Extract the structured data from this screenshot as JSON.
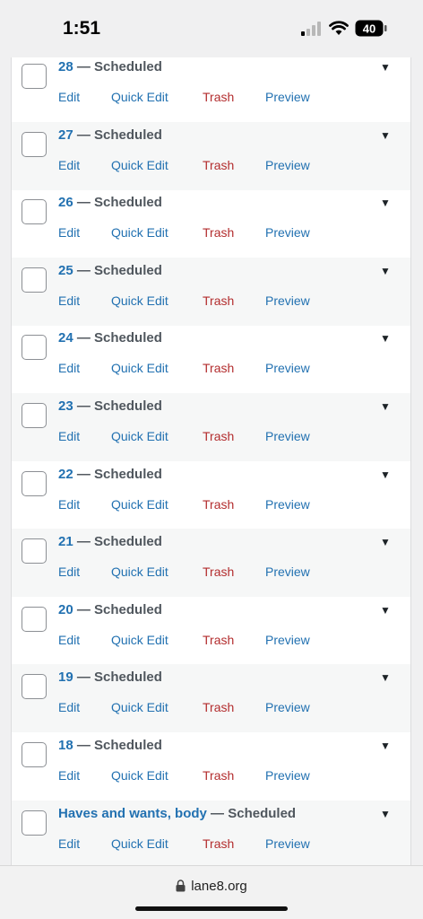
{
  "status": {
    "time": "1:51",
    "battery_level": "40",
    "signal_icon": "cellular-signal-icon",
    "wifi_icon": "wifi-icon",
    "battery_icon": "battery-icon"
  },
  "colors": {
    "link": "#2271b1",
    "trash": "#b32d2e",
    "muted_text": "#50575e",
    "row_alt_bg": "#f6f7f7"
  },
  "row_actions": {
    "edit": "Edit",
    "quick_edit": "Quick Edit",
    "trash": "Trash",
    "preview": "Preview"
  },
  "posts": [
    {
      "title": "28",
      "state": " — Scheduled"
    },
    {
      "title": "27",
      "state": " — Scheduled"
    },
    {
      "title": "26",
      "state": " — Scheduled"
    },
    {
      "title": "25",
      "state": " — Scheduled"
    },
    {
      "title": "24",
      "state": " — Scheduled"
    },
    {
      "title": "23",
      "state": " — Scheduled"
    },
    {
      "title": "22",
      "state": " — Scheduled"
    },
    {
      "title": "21",
      "state": " — Scheduled"
    },
    {
      "title": "20",
      "state": " — Scheduled"
    },
    {
      "title": "19",
      "state": " — Scheduled"
    },
    {
      "title": "18",
      "state": " — Scheduled"
    },
    {
      "title": "Haves and wants, body",
      "state": " — Scheduled"
    }
  ],
  "browser": {
    "url": "lane8.org",
    "lock_icon": "lock-icon"
  }
}
